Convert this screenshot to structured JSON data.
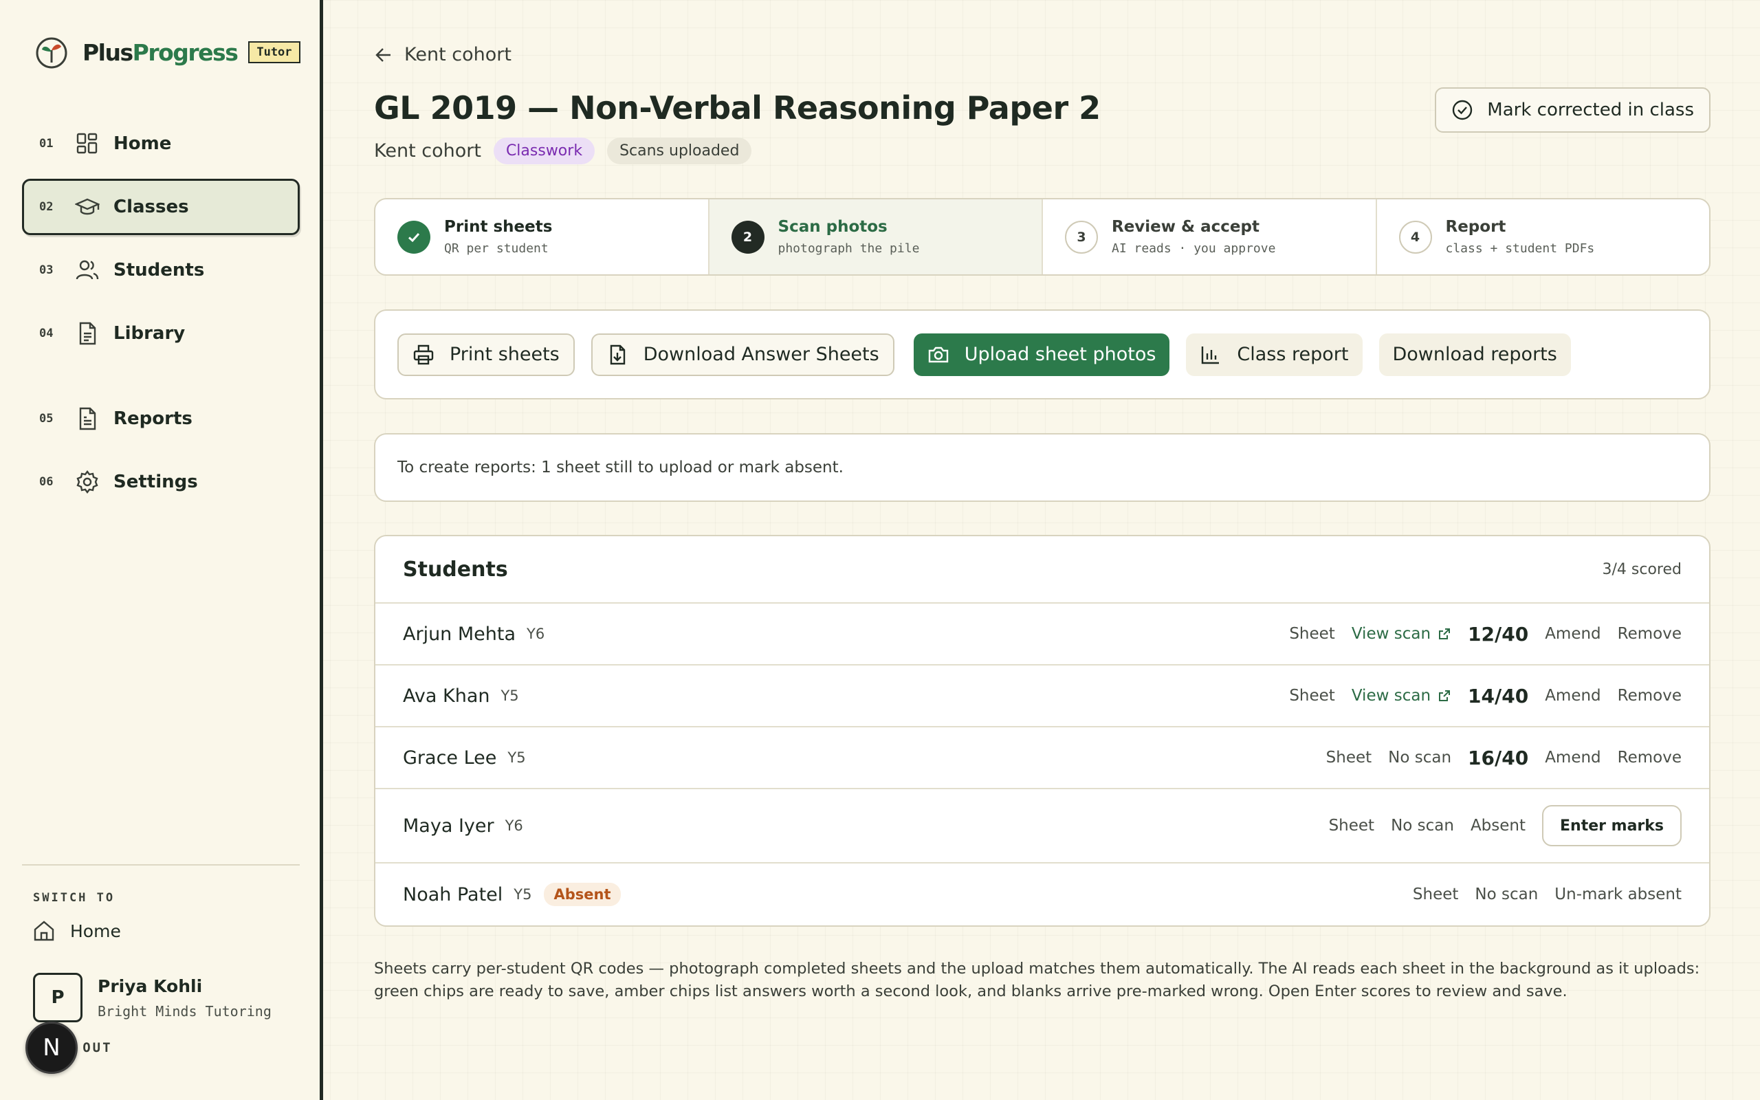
{
  "brand": {
    "name_a": "Plus",
    "name_b": "Progress",
    "tag": "Tutor"
  },
  "nav": [
    {
      "num": "01",
      "label": "Home",
      "icon": "grid-icon"
    },
    {
      "num": "02",
      "label": "Classes",
      "icon": "graduation-cap-icon",
      "active": true
    },
    {
      "num": "03",
      "label": "Students",
      "icon": "users-icon"
    },
    {
      "num": "04",
      "label": "Library",
      "icon": "document-icon"
    },
    {
      "num": "05",
      "label": "Reports",
      "icon": "report-icon"
    },
    {
      "num": "06",
      "label": "Settings",
      "icon": "gear-icon"
    }
  ],
  "switch": {
    "heading": "SWITCH TO",
    "home": "Home"
  },
  "user": {
    "initial": "P",
    "name": "Priya Kohli",
    "org": "Bright Minds Tutoring",
    "sign_out": "SIGN OUT",
    "badge": "N"
  },
  "header": {
    "back": "Kent cohort",
    "title": "GL 2019 — Non-Verbal Reasoning Paper 2",
    "cohort": "Kent cohort",
    "chips": [
      "Classwork",
      "Scans uploaded"
    ],
    "mark_corrected": "Mark corrected in class"
  },
  "steps": [
    {
      "n": "",
      "title": "Print sheets",
      "sub": "QR per student",
      "state": "done"
    },
    {
      "n": "2",
      "title": "Scan photos",
      "sub": "photograph the pile",
      "state": "current"
    },
    {
      "n": "3",
      "title": "Review & accept",
      "sub": "AI reads · you approve",
      "state": "todo"
    },
    {
      "n": "4",
      "title": "Report",
      "sub": "class + student PDFs",
      "state": "todo"
    }
  ],
  "toolbar": {
    "print": "Print sheets",
    "download_answers": "Download Answer Sheets",
    "upload": "Upload sheet photos",
    "class_report": "Class report",
    "download_reports": "Download reports"
  },
  "notice": "To create reports: 1 sheet still to upload or mark absent.",
  "students": {
    "title": "Students",
    "scored": "3/4 scored",
    "rows": [
      {
        "name": "Arjun Mehta",
        "year": "Y6",
        "sheet": "Sheet",
        "scan": "View scan",
        "score": "12/40",
        "amend": "Amend",
        "remove": "Remove"
      },
      {
        "name": "Ava Khan",
        "year": "Y5",
        "sheet": "Sheet",
        "scan": "View scan",
        "score": "14/40",
        "amend": "Amend",
        "remove": "Remove"
      },
      {
        "name": "Grace Lee",
        "year": "Y5",
        "sheet": "Sheet",
        "scan": "No scan",
        "score": "16/40",
        "amend": "Amend",
        "remove": "Remove"
      },
      {
        "name": "Maya Iyer",
        "year": "Y6",
        "sheet": "Sheet",
        "scan": "No scan",
        "status": "Absent",
        "action": "Enter marks"
      },
      {
        "name": "Noah Patel",
        "year": "Y5",
        "badge": "Absent",
        "sheet": "Sheet",
        "scan": "No scan",
        "action": "Un-mark absent"
      }
    ]
  },
  "footnote": "Sheets carry per-student QR codes — photograph completed sheets and the upload matches them automatically. The AI reads each sheet in the background as it uploads: green chips are ready to save, amber chips list answers worth a second look, and blanks arrive pre-marked wrong. Open Enter scores to review and save.",
  "colors": {
    "accent": "#2c7a4b",
    "ink": "#1f2a22",
    "paper": "#faf7ea",
    "absent": "#b4541a",
    "classwork": "#7a2bb0"
  }
}
